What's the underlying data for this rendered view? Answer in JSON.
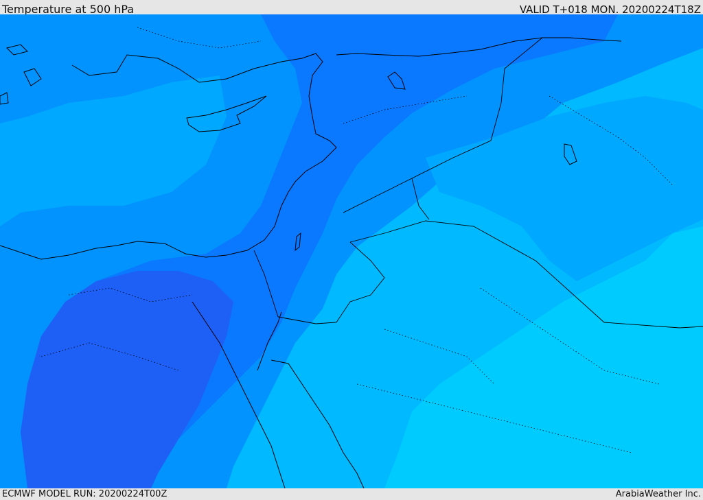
{
  "header": {
    "title": "Temperature at 500 hPa",
    "valid": "VALID T+018 MON. 20200224T18Z"
  },
  "footer": {
    "model_run": "ECMWF MODEL RUN: 20200224T00Z",
    "credit": "ArabiaWeather Inc."
  },
  "colors": {
    "band_coldest": "#1e5ff5",
    "band_cold": "#0a78ff",
    "band_mid": "#0293ff",
    "band_cool": "#00a8ff",
    "band_mild": "#00b9ff",
    "band_warm": "#00cbff",
    "coastline": "#000000",
    "border": "#000000"
  }
}
